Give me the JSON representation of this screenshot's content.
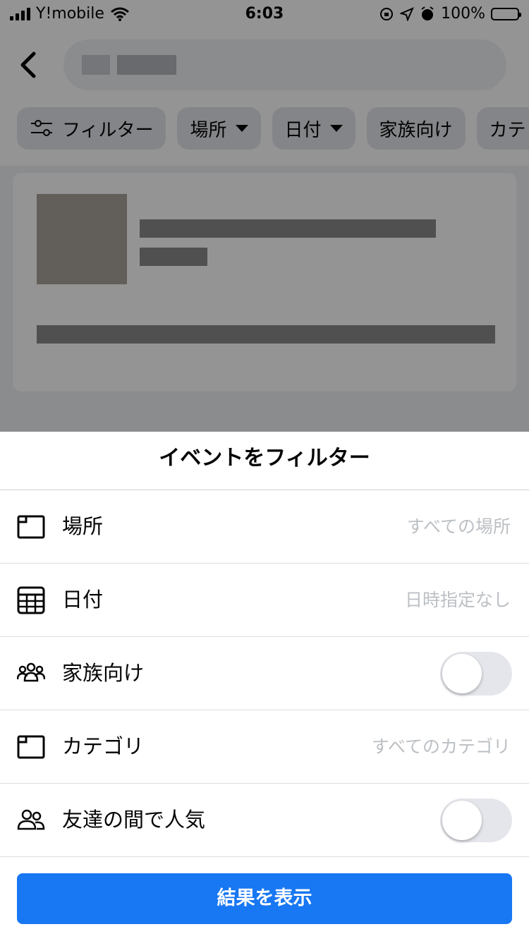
{
  "status_bar": {
    "carrier": "Y!mobile",
    "time": "6:03",
    "battery": "100%"
  },
  "header": {
    "back_icon": "chevron-left-icon",
    "search_placeholder": ""
  },
  "filter_chips": {
    "filter_label": "フィルター",
    "location_label": "場所",
    "date_label": "日付",
    "family_label": "家族向け",
    "category_label_partial": "カテ"
  },
  "sheet": {
    "title": "イベントをフィルター",
    "rows": [
      {
        "label": "場所",
        "value": "すべての場所",
        "icon": "map-icon"
      },
      {
        "label": "日付",
        "value": "日時指定なし",
        "icon": "calendar-icon"
      },
      {
        "label": "家族向け",
        "toggle_on": false,
        "icon": "family-icon"
      },
      {
        "label": "カテゴリ",
        "value": "すべてのカテゴリ",
        "icon": "map-icon"
      },
      {
        "label": "友達の間で人気",
        "toggle_on": false,
        "icon": "friends-icon"
      }
    ],
    "show_results_label": "結果を表示"
  },
  "colors": {
    "accent": "#1877f2",
    "chip_bg": "#e4e6eb",
    "muted_text": "#bcc0c4"
  }
}
